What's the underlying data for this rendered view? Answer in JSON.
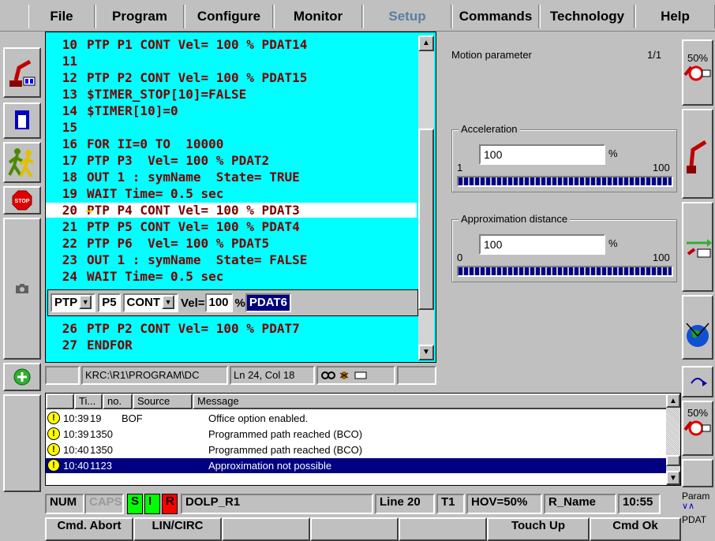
{
  "menu": {
    "items": [
      {
        "label": "File"
      },
      {
        "label": "Program"
      },
      {
        "label": "Configure"
      },
      {
        "label": "Monitor"
      },
      {
        "label": "Setup"
      },
      {
        "label": "Commands"
      },
      {
        "label": "Technology"
      },
      {
        "label": "Help"
      }
    ],
    "active": "Setup"
  },
  "editor": {
    "lines": [
      {
        "no": "10",
        "text": "PTP P1 CONT Vel= 100 % PDAT14"
      },
      {
        "no": "11",
        "text": ""
      },
      {
        "no": "12",
        "text": "PTP P2 CONT Vel= 100 % PDAT15"
      },
      {
        "no": "13",
        "text": "$TIMER_STOP[10]=FALSE"
      },
      {
        "no": "14",
        "text": "$TIMER[10]=0"
      },
      {
        "no": "15",
        "text": ""
      },
      {
        "no": "16",
        "text": "FOR II=0 TO  10000"
      },
      {
        "no": "17",
        "text": "PTP P3  Vel= 100 % PDAT2"
      },
      {
        "no": "18",
        "text": "OUT 1 : symName  State= TRUE"
      },
      {
        "no": "19",
        "text": "WAIT Time= 0.5 sec"
      },
      {
        "no": "20",
        "text": "PTP P4 CONT Vel= 100 % PDAT3"
      },
      {
        "no": "21",
        "text": "PTP P5 CONT Vel= 100 % PDAT4"
      },
      {
        "no": "22",
        "text": "PTP P6  Vel= 100 % PDAT5"
      },
      {
        "no": "23",
        "text": "OUT 1 : symName  State= FALSE"
      },
      {
        "no": "24",
        "text": "WAIT Time= 0.5 sec"
      },
      {
        "no": "26",
        "text": "PTP P2 CONT Vel= 100 % PDAT7"
      },
      {
        "no": "27",
        "text": "ENDFOR"
      }
    ],
    "current_line": "20",
    "inline_form": {
      "motion": "PTP",
      "point": "P5",
      "cont": "CONT",
      "vel_label": "Vel=",
      "vel_value": "100",
      "unit": "%",
      "pdat": "PDAT6"
    },
    "status": {
      "path": "KRC:\\R1\\PROGRAM\\DC",
      "position": "Ln 24, Col 18"
    }
  },
  "motion_panel": {
    "title": "Motion parameter",
    "page": "1/1",
    "acceleration": {
      "label": "Acceleration",
      "value": "100",
      "unit": "%",
      "min": "1",
      "max": "100",
      "level": 1.0
    },
    "approximation": {
      "label": "Approximation distance",
      "value": "100",
      "unit": "%",
      "min": "0",
      "max": "100",
      "level": 1.0
    }
  },
  "right_toolbar": {
    "override_top": "50%",
    "override_bottom": "50%",
    "param_label": "Param",
    "pdat_label": "PDAT"
  },
  "messages": {
    "columns": [
      "Ti...",
      "no.",
      "Source",
      "Message"
    ],
    "rows": [
      {
        "time": "10:39",
        "no": "19",
        "source": "BOF",
        "message": "Office option enabled."
      },
      {
        "time": "10:39",
        "no": "1350",
        "source": "",
        "message": "Programmed path reached (BCO)"
      },
      {
        "time": "10:40",
        "no": "1350",
        "source": "",
        "message": "Programmed path reached (BCO)"
      },
      {
        "time": "10:40",
        "no": "1123",
        "source": "",
        "message": "Approximation not possible"
      }
    ]
  },
  "status_bar": {
    "num": "NUM",
    "caps": "CAPS",
    "s": "S",
    "i": "I",
    "r": "R",
    "robot": "DOLP_R1",
    "line": "Line 20",
    "mode": "T1",
    "hov": "HOV=50%",
    "rname": "R_Name",
    "time": "10:55"
  },
  "softkeys": {
    "cmd_abort": "Cmd. Abort",
    "lin_circ": "LIN/CIRC",
    "touch_up": "Touch Up",
    "cmd_ok": "Cmd Ok"
  },
  "colors": {
    "editor_bg": "#00ffff",
    "code_text": "#7a0000",
    "selection": "#000080",
    "progress": "#00008b",
    "status_green": "#00ff00",
    "status_red": "#ff0000"
  }
}
